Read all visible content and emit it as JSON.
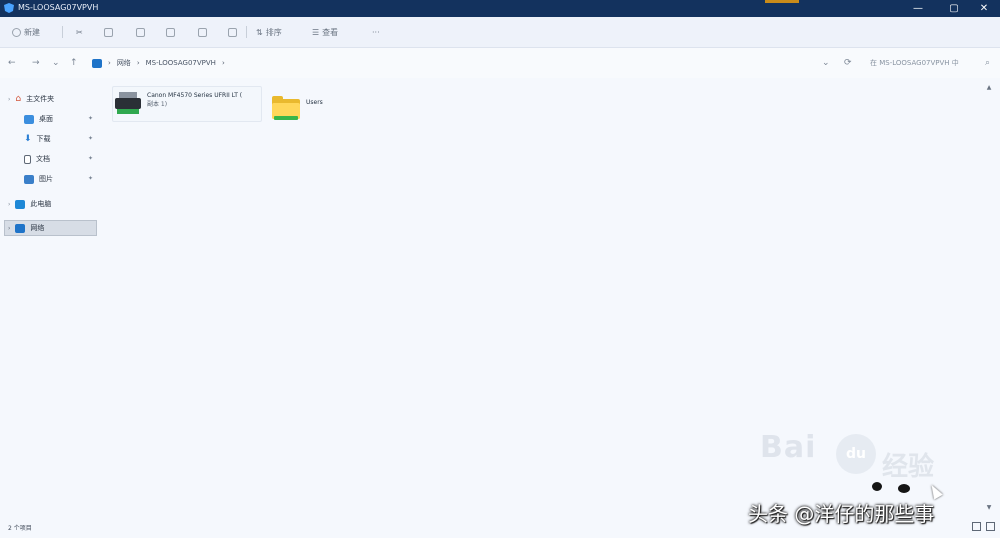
{
  "window": {
    "title": "MS-LOOSAG07VPVH",
    "controls": [
      "—",
      "▢",
      "✕"
    ]
  },
  "toolbar": {
    "items": [
      {
        "label": "新建",
        "icon": "new-icon"
      },
      {
        "label": "",
        "icon": "cut-icon"
      },
      {
        "label": "",
        "icon": "copy-icon"
      },
      {
        "label": "",
        "icon": "paste-icon"
      },
      {
        "label": "",
        "icon": "rename-icon"
      },
      {
        "label": "",
        "icon": "share-icon"
      },
      {
        "label": "",
        "icon": "delete-icon"
      },
      {
        "label": "排序",
        "icon": "sort-icon"
      },
      {
        "label": "查看",
        "icon": "view-icon"
      },
      {
        "label": "···",
        "icon": "more-icon"
      }
    ]
  },
  "address": {
    "back": "←",
    "forward": "→",
    "up": "↑",
    "path": [
      "网络",
      "MS-LOOSAG07VPVH"
    ],
    "refresh": "⟳",
    "search_placeholder": "在 MS-LOOSAG07VPVH 中"
  },
  "sidebar": {
    "items": [
      {
        "label": "主文件夹",
        "icon": "home-icon",
        "pinned": false
      },
      {
        "label": "桌面",
        "icon": "desktop-icon",
        "pinned": true
      },
      {
        "label": "下载",
        "icon": "download-icon",
        "pinned": true
      },
      {
        "label": "文档",
        "icon": "document-icon",
        "pinned": true
      },
      {
        "label": "图片",
        "icon": "pictures-icon",
        "pinned": true
      },
      {
        "label": "此电脑",
        "icon": "pc-icon",
        "pinned": false
      },
      {
        "label": "网络",
        "icon": "network-icon",
        "pinned": false,
        "selected": true
      }
    ]
  },
  "content": {
    "printer": {
      "name": "Canon MF4570 Series UFRII LT (",
      "sub": "副本 1)"
    },
    "folder": {
      "name": "Users"
    }
  },
  "status": {
    "count": "2 个项目"
  },
  "watermarks": {
    "baidu": "Bai",
    "baidu_paw": "du",
    "baidu_tail": "经验",
    "toutiao": "头条 @洋仔的那些事"
  },
  "colors": {
    "titlebar": "#13325e",
    "background": "#f5f8fd",
    "accent": "#1e73c8",
    "folder": "#ffd75a"
  }
}
